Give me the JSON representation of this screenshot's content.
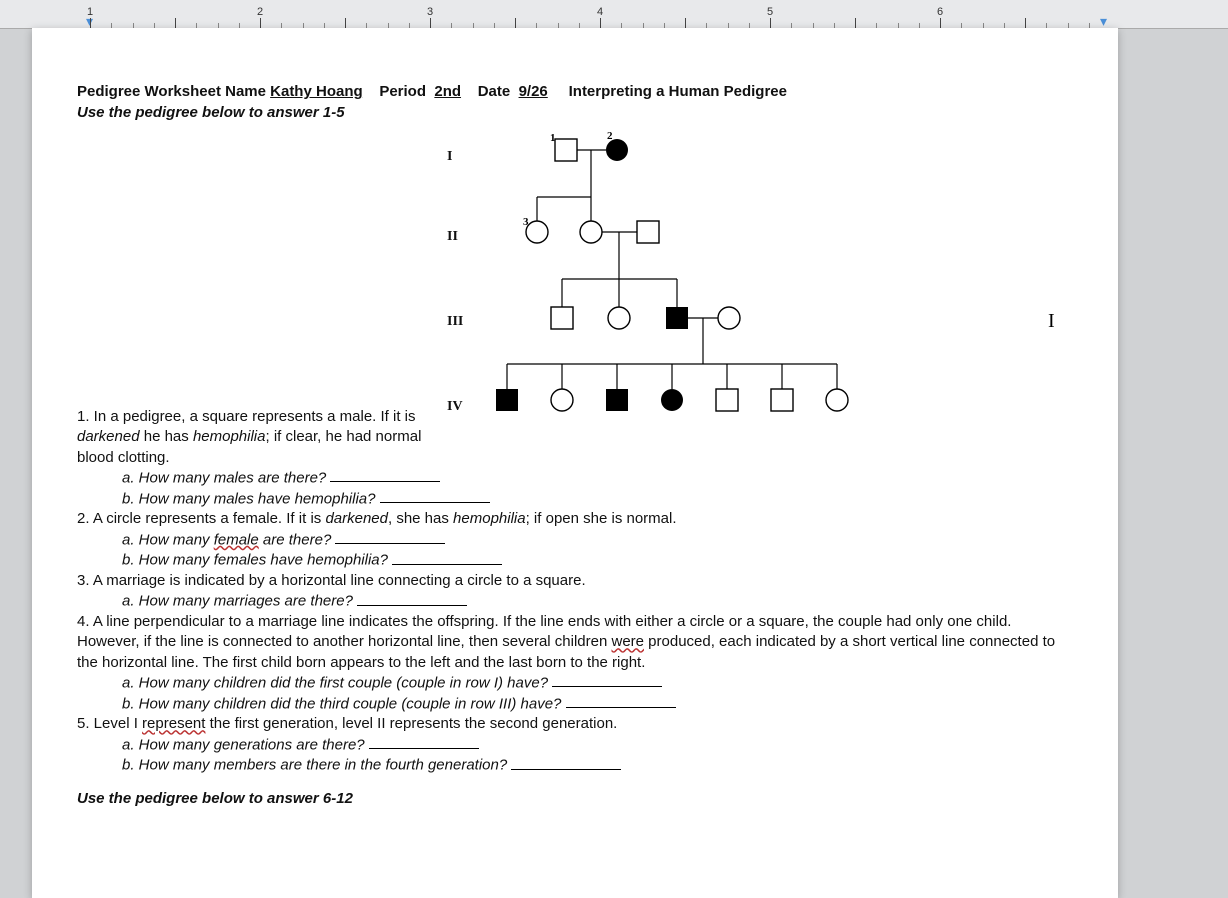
{
  "ruler": {
    "numbers": [
      "1",
      "2",
      "3",
      "4",
      "5",
      "6"
    ]
  },
  "header": {
    "title_prefix": "Pedigree Worksheet Name ",
    "name": "Kathy Hoang",
    "period_label": "Period",
    "period": "2nd",
    "date_label": "Date",
    "date": "9/26",
    "title_suffix": "Interpreting a Human Pedigree",
    "instruction": "Use the pedigree below to answer 1-5"
  },
  "generations": {
    "g1": "I",
    "g2": "II",
    "g3": "III",
    "g4": "IV"
  },
  "questions": {
    "q1_intro": "1. In a pedigree, a square represents a male. If it is ",
    "q1_dark": "darkened",
    "q1_mid": " he has ",
    "q1_hemo": "hemophilia",
    "q1_end": "; if clear, he had normal blood  clotting.",
    "q1a": "a. How many males are there?",
    "q1b": "b. How many males have hemophilia?",
    "q2_a": "2. A circle represents a female. If it is ",
    "q2_dark": "darkened",
    "q2_b": ", she has ",
    "q2_hemo": "hemophilia",
    "q2_c": "; if open she is normal.",
    "q2a_pre": "a. How many ",
    "q2a_fem": "female",
    "q2a_post": " are there?",
    "q2b": "b. How many females have hemophilia?",
    "q3": "3. A marriage is indicated by a horizontal line connecting a circle to a square.",
    "q3a": "a. How many marriages are there?",
    "q4_a": "4. A line perpendicular to a marriage line indicates the offspring. If the line ends with either a circle or a square, the couple had only one child. However, if the line is connected to another horizontal line, then several children ",
    "q4_were": "were",
    "q4_b": " produced, each indicated by a short vertical line connected to the horizontal line. The first child born appears to the left and the last born to the right.",
    "q4a": "a. How many children did the first couple (couple in row I) have?",
    "q4b": "b. How many children did the third couple (couple in row III) have?",
    "q5_a": "5. Level I ",
    "q5_rep": "represent",
    "q5_b": " the first generation, level II represents the second generation.",
    "q5a": "a. How many generations are there?",
    "q5b": "b. How many members are there in the fourth generation?"
  },
  "section2": "Use the pedigree below to answer 6-12",
  "chart_data": {
    "type": "pedigree",
    "title": "Human Pedigree (hemophilia)",
    "legend": {
      "square": "male",
      "circle": "female",
      "filled": "affected (hemophilia)",
      "open": "unaffected"
    },
    "generations": [
      {
        "label": "I",
        "members": [
          {
            "id": 1,
            "sex": "male",
            "affected": false
          },
          {
            "id": 2,
            "sex": "female",
            "affected": true
          }
        ],
        "marriages": [
          {
            "partners": [
              1,
              2
            ],
            "children_gen": "II",
            "children": [
              3,
              4
            ]
          }
        ]
      },
      {
        "label": "II",
        "members": [
          {
            "id": 3,
            "sex": "female",
            "affected": false
          },
          {
            "id": 4,
            "sex": "female",
            "affected": false
          },
          {
            "id": 5,
            "sex": "male",
            "affected": false
          }
        ],
        "marriages": [
          {
            "partners": [
              4,
              5
            ],
            "children_gen": "III",
            "children": [
              6,
              7,
              8
            ]
          }
        ]
      },
      {
        "label": "III",
        "members": [
          {
            "id": 6,
            "sex": "male",
            "affected": false
          },
          {
            "id": 7,
            "sex": "female",
            "affected": false
          },
          {
            "id": 8,
            "sex": "male",
            "affected": true
          },
          {
            "id": 9,
            "sex": "female",
            "affected": false
          }
        ],
        "marriages": [
          {
            "partners": [
              8,
              9
            ],
            "children_gen": "IV",
            "children": [
              10,
              11,
              12,
              13,
              14,
              15,
              16
            ]
          }
        ]
      },
      {
        "label": "IV",
        "members": [
          {
            "id": 10,
            "sex": "male",
            "affected": true
          },
          {
            "id": 11,
            "sex": "female",
            "affected": false
          },
          {
            "id": 12,
            "sex": "male",
            "affected": true
          },
          {
            "id": 13,
            "sex": "female",
            "affected": true
          },
          {
            "id": 14,
            "sex": "male",
            "affected": false
          },
          {
            "id": 15,
            "sex": "male",
            "affected": false
          },
          {
            "id": 16,
            "sex": "female",
            "affected": false
          }
        ]
      }
    ]
  }
}
